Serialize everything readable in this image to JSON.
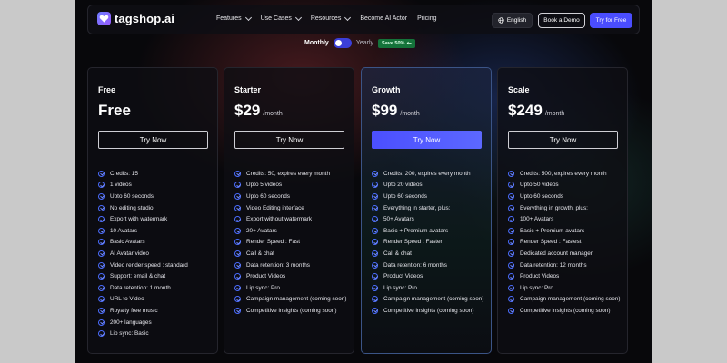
{
  "nav": {
    "brand": "tagshop.ai",
    "menu": [
      {
        "label": "Features",
        "has_dropdown": true
      },
      {
        "label": "Use Cases",
        "has_dropdown": true
      },
      {
        "label": "Resources",
        "has_dropdown": true
      },
      {
        "label": "Become AI Actor",
        "has_dropdown": false
      },
      {
        "label": "Pricing",
        "has_dropdown": false
      }
    ],
    "language": "English",
    "book_demo": "Book a Demo",
    "try_free": "Try for Free"
  },
  "billing": {
    "monthly": "Monthly",
    "yearly": "Yearly",
    "save_badge": "Save 50%",
    "selected": "Monthly"
  },
  "colors": {
    "accent": "#4a4dff",
    "badge": "#14733a",
    "check": "#4a6cff"
  },
  "plans": [
    {
      "name": "Free",
      "price": "Free",
      "period": "",
      "button": "Try Now",
      "features": [
        "Credits: 15",
        "1 videos",
        "Upto 60 seconds",
        "No editing studio",
        "Export with watermark",
        "10 Avatars",
        "Basic Avatars",
        "AI Avatar video",
        "Video render speed : standard",
        "Support: email & chat",
        "Data retention: 1 month",
        "URL to Video",
        "Royalty free music",
        "200+ languages",
        "Lip sync: Basic"
      ]
    },
    {
      "name": "Starter",
      "price": "$29",
      "period": "/month",
      "button": "Try Now",
      "features": [
        "Credits: 50, expires every month",
        "Upto 5 videos",
        "Upto 60 seconds",
        "Video Editing interface",
        "Export without watermark",
        "20+ Avatars",
        "Render Speed : Fast",
        "Call & chat",
        "Data retention: 3 months",
        "Product Videos",
        "Lip sync: Pro",
        "Campaign management (coming soon)",
        "Competitive insights (coming soon)"
      ]
    },
    {
      "name": "Growth",
      "price": "$99",
      "period": "/month",
      "button": "Try Now",
      "features": [
        "Credits: 200, expires every month",
        "Upto 20 videos",
        "Upto 60 seconds",
        "Everything in starter, plus:",
        "50+ Avatars",
        "Basic + Premium avatars",
        "Render Speed : Faster",
        "Call & chat",
        "Data retention: 6 months",
        "Product Videos",
        "Lip sync: Pro",
        "Campaign management (coming soon)",
        "Competitive insights (coming soon)"
      ]
    },
    {
      "name": "Scale",
      "price": "$249",
      "period": "/month",
      "button": "Try Now",
      "features": [
        "Credits: 500, expires every month",
        "Upto 50 videos",
        "Upto 60 seconds",
        "Everything in growth, plus:",
        "100+ Avatars",
        "Basic + Premium avatars",
        "Render Speed : Fastest",
        "Dedicated account manager",
        "Data retention: 12 months",
        "Product Videos",
        "Lip sync: Pro",
        "Campaign management (coming soon)",
        "Competitive insights (coming soon)"
      ]
    }
  ]
}
